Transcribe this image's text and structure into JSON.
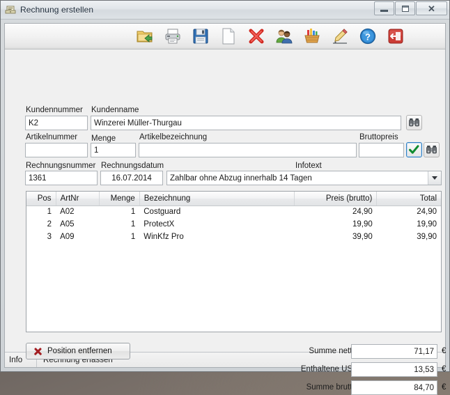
{
  "window": {
    "title": "Rechnung erstellen",
    "icon": "invoice-icon",
    "buttons": {
      "minimize": "Minimieren",
      "maximize": "Maximieren",
      "close": "Schließen"
    }
  },
  "toolbar": {
    "items": [
      {
        "name": "open-folder-icon",
        "tooltip": "Öffnen"
      },
      {
        "name": "print-icon",
        "tooltip": "Drucken"
      },
      {
        "name": "save-floppy-icon",
        "tooltip": "Speichern"
      },
      {
        "name": "new-document-icon",
        "tooltip": "Neu"
      },
      {
        "name": "delete-x-icon",
        "tooltip": "Löschen"
      },
      {
        "name": "customers-icon",
        "tooltip": "Kunden"
      },
      {
        "name": "articles-basket-icon",
        "tooltip": "Artikel"
      },
      {
        "name": "edit-pencil-icon",
        "tooltip": "Bearbeiten"
      },
      {
        "name": "help-question-icon",
        "tooltip": "Hilfe"
      },
      {
        "name": "exit-door-icon",
        "tooltip": "Beenden"
      }
    ]
  },
  "form": {
    "kundennummer": {
      "label": "Kundennummer",
      "value": "K2"
    },
    "kundenname": {
      "label": "Kundenname",
      "value": "Winzerei Müller-Thurgau"
    },
    "kunden_search_button": "Kunde suchen",
    "artikelnummer": {
      "label": "Artikelnummer",
      "value": ""
    },
    "menge": {
      "label": "Menge",
      "value": "1"
    },
    "artikelbezeichnung": {
      "label": "Artikelbezeichnung",
      "value": ""
    },
    "bruttopreis": {
      "label": "Bruttopreis",
      "value": ""
    },
    "artikel_ok_button": "Übernehmen",
    "artikel_search_button": "Artikel suchen",
    "rechnungsnummer": {
      "label": "Rechnungsnummer",
      "value": "1361"
    },
    "rechnungsdatum": {
      "label": "Rechnungsdatum",
      "value": "16.07.2014"
    },
    "infotext": {
      "label": "Infotext",
      "value": "Zahlbar ohne Abzug innerhalb 14 Tagen"
    }
  },
  "grid": {
    "columns": [
      "Pos",
      "ArtNr",
      "Menge",
      "Bezeichnung",
      "Preis (brutto)",
      "Total"
    ],
    "rows": [
      {
        "pos": "1",
        "artnr": "A02",
        "menge": "1",
        "bezeichnung": "Costguard",
        "preis": "24,90",
        "total": "24,90"
      },
      {
        "pos": "2",
        "artnr": "A05",
        "menge": "1",
        "bezeichnung": "ProtectX",
        "preis": "19,90",
        "total": "19,90"
      },
      {
        "pos": "3",
        "artnr": "A09",
        "menge": "1",
        "bezeichnung": "WinKfz Pro",
        "preis": "39,90",
        "total": "39,90"
      }
    ]
  },
  "actions": {
    "remove_position": "Position entfernen"
  },
  "totals": {
    "currency_symbol": "€",
    "netto": {
      "label": "Summe netto:",
      "value": "71,17"
    },
    "ust": {
      "label": "Enthaltene UST:",
      "value": "13,53"
    },
    "brutto": {
      "label": "Summe brutto:",
      "value": "84,70"
    }
  },
  "statusbar": {
    "left": "Info",
    "right": "Rechnung erfassen"
  }
}
